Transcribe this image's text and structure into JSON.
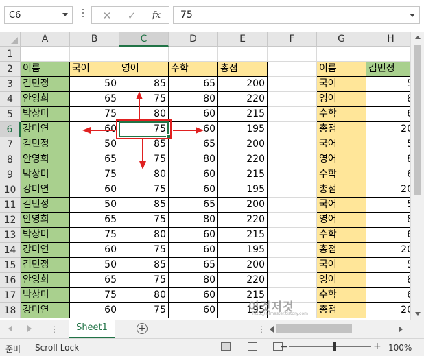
{
  "formula_bar": {
    "name_box": "C6",
    "cancel_icon": "✕",
    "enter_icon": "✓",
    "fx_label": "fx",
    "formula": "75"
  },
  "columns": [
    "A",
    "B",
    "C",
    "D",
    "E",
    "F",
    "G",
    "H"
  ],
  "rows": [
    "1",
    "2",
    "3",
    "4",
    "5",
    "6",
    "7",
    "8",
    "9",
    "10",
    "11",
    "12",
    "13",
    "14",
    "15",
    "16",
    "17",
    "18"
  ],
  "selection": {
    "cell": "C6",
    "column": "C",
    "row": "6"
  },
  "table": {
    "headers": [
      "이름",
      "국어",
      "영어",
      "수학",
      "총점"
    ],
    "records": [
      [
        "김민정",
        "50",
        "85",
        "65",
        "200"
      ],
      [
        "안영희",
        "65",
        "75",
        "80",
        "220"
      ],
      [
        "박상미",
        "75",
        "80",
        "60",
        "215"
      ],
      [
        "강미연",
        "60",
        "75",
        "60",
        "195"
      ],
      [
        "김민정",
        "50",
        "85",
        "65",
        "200"
      ],
      [
        "안영희",
        "65",
        "75",
        "80",
        "220"
      ],
      [
        "박상미",
        "75",
        "80",
        "60",
        "215"
      ],
      [
        "강미연",
        "60",
        "75",
        "60",
        "195"
      ],
      [
        "김민정",
        "50",
        "85",
        "65",
        "200"
      ],
      [
        "안영희",
        "65",
        "75",
        "80",
        "220"
      ],
      [
        "박상미",
        "75",
        "80",
        "60",
        "215"
      ],
      [
        "강미연",
        "60",
        "75",
        "60",
        "195"
      ],
      [
        "김민정",
        "50",
        "85",
        "65",
        "200"
      ],
      [
        "안영희",
        "65",
        "75",
        "80",
        "220"
      ],
      [
        "박상미",
        "75",
        "80",
        "60",
        "215"
      ],
      [
        "강미연",
        "60",
        "75",
        "60",
        "195"
      ]
    ]
  },
  "transposed": {
    "header": [
      "이름",
      "김민정"
    ],
    "records": [
      [
        "국어",
        "5"
      ],
      [
        "영어",
        "8"
      ],
      [
        "수학",
        "6"
      ],
      [
        "총점",
        "20"
      ],
      [
        "국어",
        "5"
      ],
      [
        "영어",
        "8"
      ],
      [
        "수학",
        "6"
      ],
      [
        "총점",
        "20"
      ],
      [
        "국어",
        "5"
      ],
      [
        "영어",
        "8"
      ],
      [
        "수학",
        "6"
      ],
      [
        "총점",
        "20"
      ],
      [
        "국어",
        "5"
      ],
      [
        "영어",
        "8"
      ],
      [
        "수학",
        "6"
      ],
      [
        "총점",
        "20"
      ]
    ]
  },
  "colors": {
    "name_fill": "#a9d08e",
    "header_fill": "#ffe699",
    "selection": "#217346",
    "annotation": "#e02020"
  },
  "sheet_tabs": [
    "Sheet1"
  ],
  "add_sheet_icon": "+",
  "status": {
    "ready": "준비",
    "scroll_lock": "Scroll Lock",
    "zoom_minus": "−",
    "zoom_plus": "+",
    "zoom": "100%"
  },
  "watermark": {
    "text": "이것저것",
    "sub": "http://allmaster.tistory.com"
  }
}
